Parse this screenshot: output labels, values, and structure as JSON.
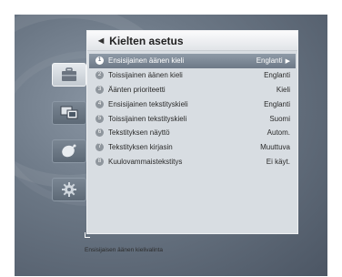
{
  "menu": {
    "title": "Kielten asetus",
    "items": [
      {
        "num": "1",
        "label": "Ensisijainen äänen kieli",
        "value": "Englanti",
        "selected": true
      },
      {
        "num": "2",
        "label": "Toissijainen äänen kieli",
        "value": "Englanti"
      },
      {
        "num": "3",
        "label": "Äänten prioriteetti",
        "value": "Kieli"
      },
      {
        "num": "4",
        "label": "Ensisijainen tekstityskieli",
        "value": "Englanti"
      },
      {
        "num": "5",
        "label": "Toissijainen tekstityskieli",
        "value": "Suomi"
      },
      {
        "num": "6",
        "label": "Tekstityksen näyttö",
        "value": "Autom."
      },
      {
        "num": "7",
        "label": "Tekstityksen kirjasin",
        "value": "Muuttuva"
      },
      {
        "num": "8",
        "label": "Kuulovammaistekstitys",
        "value": "Ei käyt."
      }
    ]
  },
  "sidebar": {
    "icons": [
      "briefcase-icon",
      "monitor-icon",
      "satellite-dish-icon",
      "gear-icon"
    ],
    "active": "briefcase-icon"
  },
  "footer": {
    "hint": "Ensisijaisen äänen kielivalinta"
  }
}
